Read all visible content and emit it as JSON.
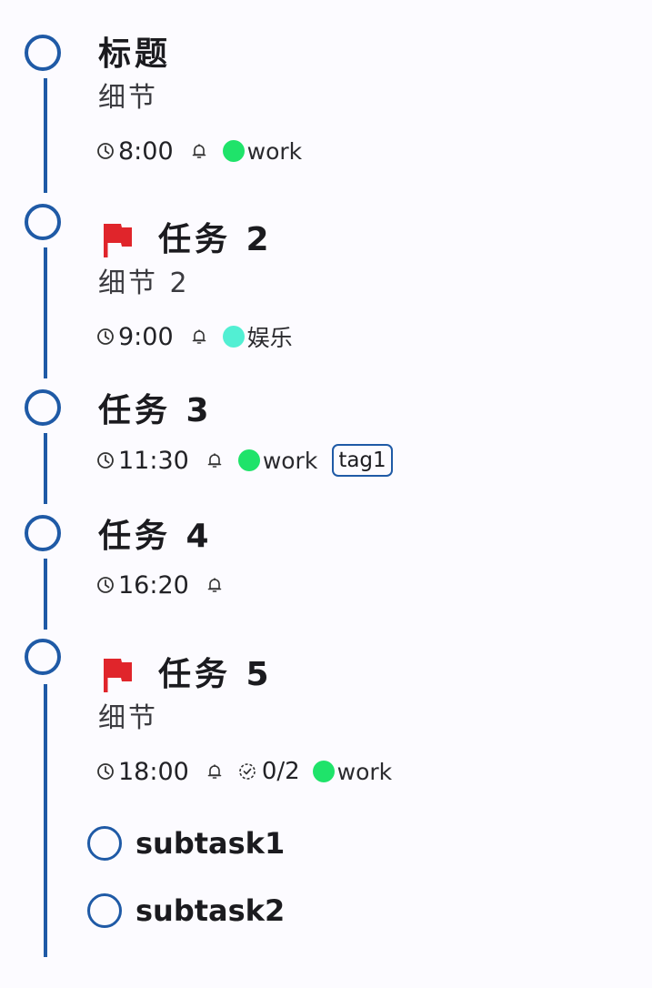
{
  "colors": {
    "accent": "#1f5aa6",
    "flag": "#e0252b",
    "category_work": "#1fe36a",
    "category_entertainment": "#52efd3"
  },
  "tasks": [
    {
      "title": "标题",
      "detail": "细节",
      "flagged": false,
      "time": "8:00",
      "category": {
        "label": "work",
        "color": "#1fe36a"
      }
    },
    {
      "title": "任务 2",
      "detail": "细节 2",
      "flagged": true,
      "time": "9:00",
      "category": {
        "label": "娱乐",
        "color": "#52efd3"
      }
    },
    {
      "title": "任务 3",
      "flagged": false,
      "time": "11:30",
      "category": {
        "label": "work",
        "color": "#1fe36a"
      },
      "tag": "tag1"
    },
    {
      "title": "任务 4",
      "flagged": false,
      "time": "16:20"
    },
    {
      "title": "任务 5",
      "detail": "细节",
      "flagged": true,
      "time": "18:00",
      "progress": "0/2",
      "category": {
        "label": "work",
        "color": "#1fe36a"
      },
      "subtasks": [
        {
          "label": "subtask1"
        },
        {
          "label": "subtask2"
        }
      ]
    }
  ],
  "icons": {
    "time": "clock-icon",
    "reminder": "bell-icon",
    "subtask_progress": "dashed-check-circle-icon",
    "priority": "flag-icon"
  }
}
